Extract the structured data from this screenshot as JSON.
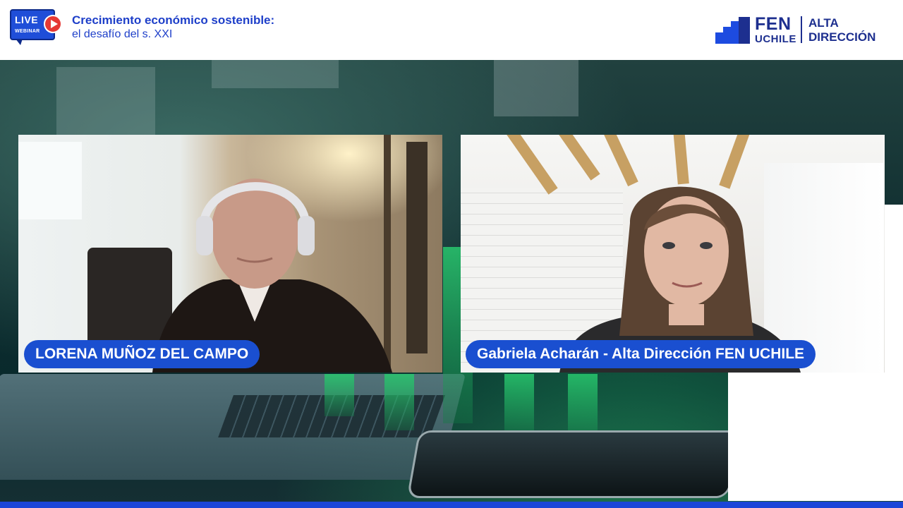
{
  "header": {
    "live_label": "LIVE",
    "webinar_label": "WEBINAR",
    "title": "Crecimiento económico sostenible:",
    "subtitle": "el desafío del s. XXI"
  },
  "logo": {
    "fen": "FEN",
    "uchile": "UCHILE",
    "alta": "ALTA",
    "direccion": "DIRECCIÓN"
  },
  "participants": [
    {
      "name": "LORENA MUÑOZ DEL CAMPO"
    },
    {
      "name": "Gabriela Acharán - Alta Dirección FEN UCHILE"
    }
  ],
  "colors": {
    "brand_blue": "#1e3fc9",
    "name_tag_blue": "#1a4fd0",
    "live_red": "#e53935"
  }
}
